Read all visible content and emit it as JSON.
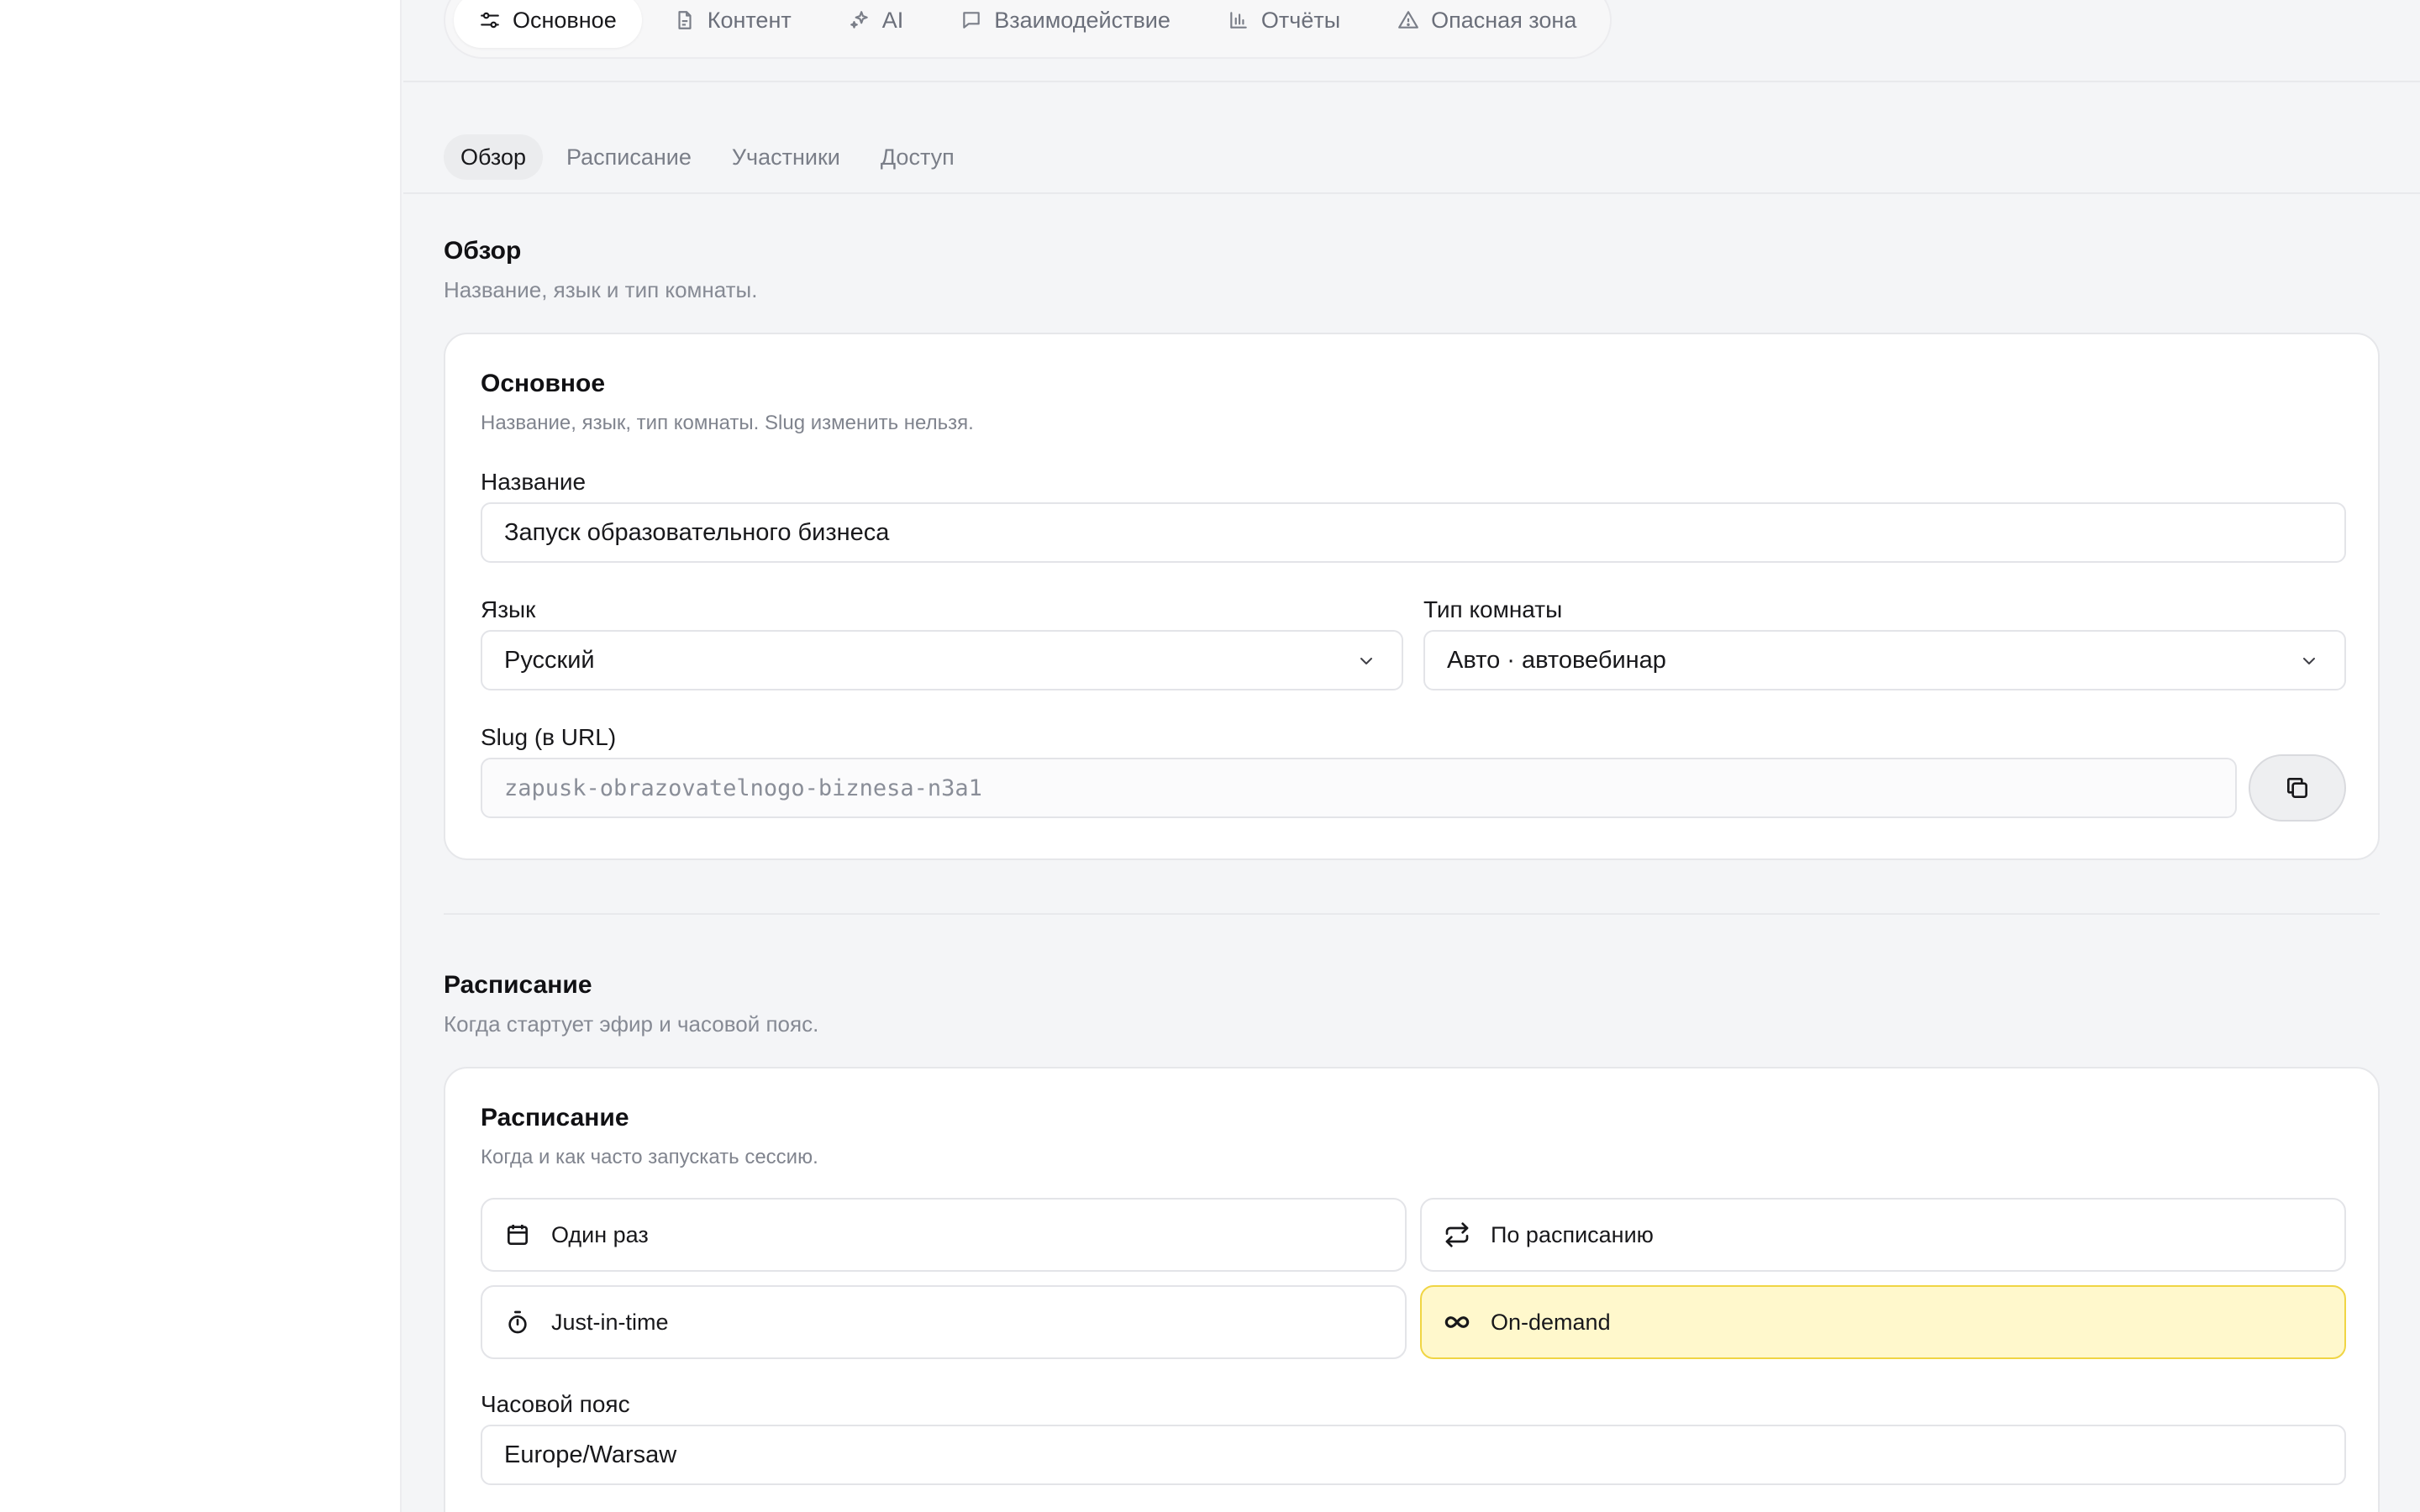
{
  "section_tabs": [
    {
      "label": "Основное",
      "icon": "sliders-icon"
    },
    {
      "label": "Контент",
      "icon": "document-icon"
    },
    {
      "label": "AI",
      "icon": "sparkles-icon"
    },
    {
      "label": "Взаимодействие",
      "icon": "chat-bubble-icon"
    },
    {
      "label": "Отчёты",
      "icon": "bar-chart-icon"
    },
    {
      "label": "Опасная зона",
      "icon": "warning-icon"
    }
  ],
  "sub_tabs": [
    "Обзор",
    "Расписание",
    "Участники",
    "Доступ"
  ],
  "overview": {
    "title": "Обзор",
    "subtitle": "Название, язык и тип комнаты.",
    "card": {
      "title": "Основное",
      "subtitle": "Название, язык, тип комнаты. Slug изменить нельзя.",
      "name_label": "Название",
      "name_value": "Запуск образовательного бизнеса",
      "language_label": "Язык",
      "language_value": "Русский",
      "room_type_label": "Тип комнаты",
      "room_type_value": "Авто · автовебинар",
      "slug_label": "Slug (в URL)",
      "slug_value": "zapusk-obrazovatelnogo-biznesa-n3a1"
    }
  },
  "schedule": {
    "title": "Расписание",
    "subtitle": "Когда стартует эфир и часовой пояс.",
    "card": {
      "title": "Расписание",
      "subtitle": "Когда и как часто запускать сессию.",
      "options": [
        {
          "label": "Один раз",
          "icon": "calendar-icon"
        },
        {
          "label": "По расписанию",
          "icon": "repeat-icon"
        },
        {
          "label": "Just-in-time",
          "icon": "stopwatch-icon"
        },
        {
          "label": "On-demand",
          "icon": "infinity-icon"
        }
      ],
      "selected_option": "On-demand",
      "timezone_label": "Часовой пояс",
      "timezone_value": "Europe/Warsaw"
    }
  },
  "colors": {
    "accent_selected_bg": "#fff8cc",
    "accent_selected_border": "#f0d544",
    "page_bg": "#f4f5f7"
  }
}
